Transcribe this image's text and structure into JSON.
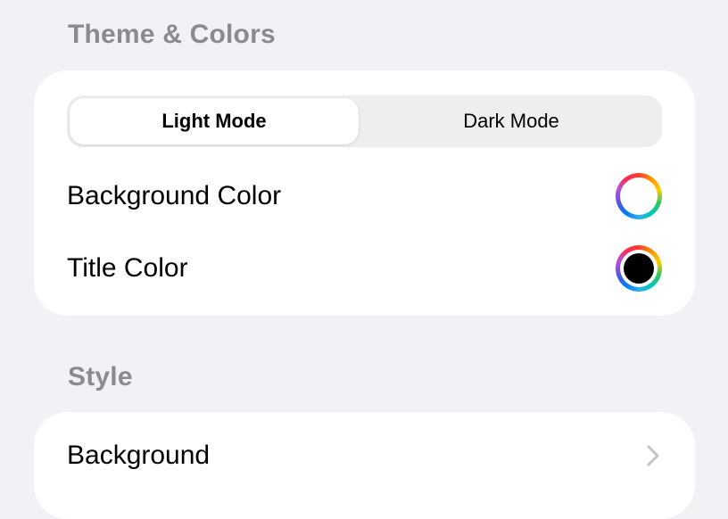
{
  "sections": {
    "theme": {
      "header": "Theme & Colors",
      "mode_segment": {
        "options": [
          "Light Mode",
          "Dark Mode"
        ],
        "selected": "Light Mode"
      },
      "rows": [
        {
          "label": "Background Color",
          "swatch_color": "#ffffff",
          "icon": "color-picker-icon"
        },
        {
          "label": "Title Color",
          "swatch_color": "#000000",
          "icon": "color-picker-icon"
        }
      ]
    },
    "style": {
      "header": "Style",
      "rows": [
        {
          "label": "Background",
          "icon": "chevron-right-icon"
        }
      ]
    }
  },
  "colors": {
    "page_background": "#f2f1f6",
    "card_background": "#ffffff",
    "section_header": "#8a8a8f",
    "segment_track": "#eeeeef",
    "chevron": "#c4c4c7"
  }
}
